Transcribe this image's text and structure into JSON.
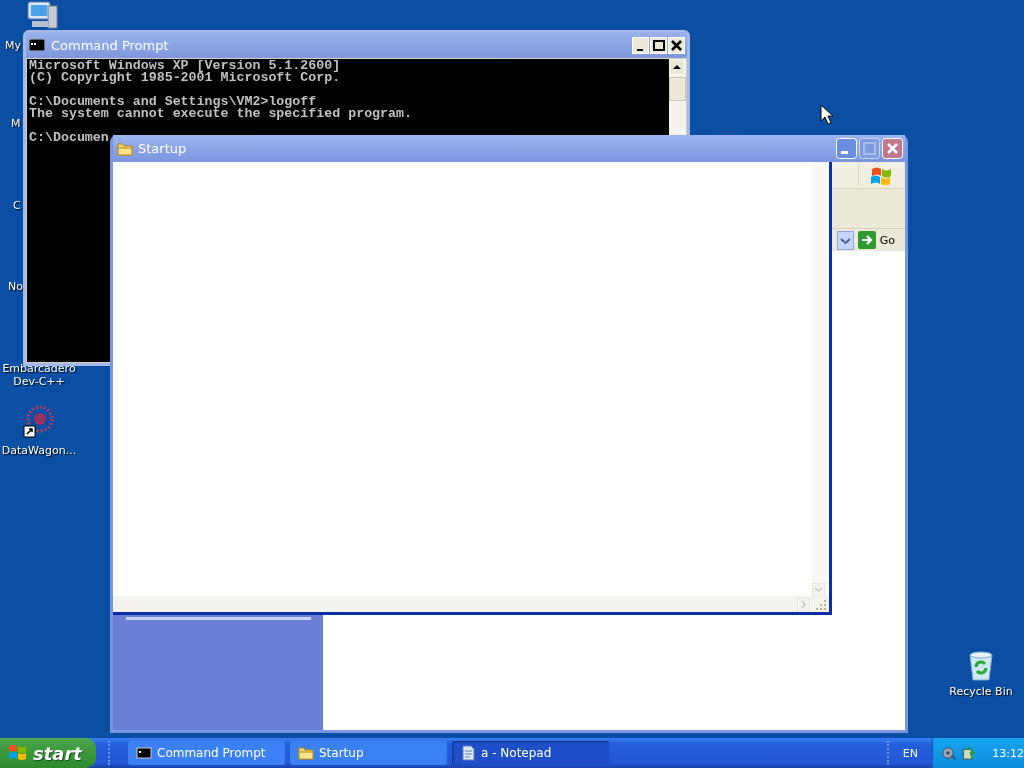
{
  "desktop_icons": [
    {
      "label": "My",
      "kind": "computer"
    },
    {
      "label": "M",
      "kind": "hidden"
    },
    {
      "label": "C",
      "kind": "hidden"
    },
    {
      "label": "No",
      "kind": "hidden"
    },
    {
      "label": "Embarcadero Dev-C++",
      "kind": "hidden"
    },
    {
      "label": "DataWagon...",
      "kind": "shortcut"
    },
    {
      "label": "Recycle Bin",
      "kind": "recycle"
    }
  ],
  "console_window": {
    "title": "Command Prompt",
    "active": false,
    "blocks": [
      [
        "Microsoft Windows XP [Version 5.1.2600]",
        "(C) Copyright 1985-2001 Microsoft Corp."
      ],
      [
        "C:\\Documents and Settings\\VM2>logoff",
        "The system cannot execute the specified program."
      ],
      [
        "C:\\Documen"
      ]
    ]
  },
  "explorer_window": {
    "title": "Startup",
    "active": false,
    "go_button": "Go"
  },
  "taskbar": {
    "start": "start",
    "tasks": [
      {
        "label": "Command Prompt",
        "kind": "console",
        "selected": false
      },
      {
        "label": "Startup",
        "kind": "folder",
        "selected": false
      },
      {
        "label": "a - Notepad",
        "kind": "notepad",
        "selected": true
      }
    ],
    "language": "EN",
    "clock": "13:12"
  }
}
